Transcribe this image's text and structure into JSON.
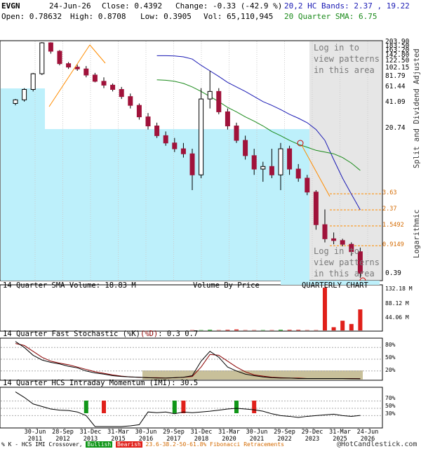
{
  "header": {
    "symbol": "EVGN",
    "date": "24-Jun-26",
    "close": "Close: 0.4392",
    "change": "Change: -0.33 (-42.9 %)",
    "bands": "20,2 HC Bands: 2.37 , 19.22",
    "open": "Open: 0.78632",
    "high": "High: 0.8708",
    "low": "Low: 0.3905",
    "vol": "Vol: 65,110,945",
    "sma": "20 Quarter SMA: 6.75"
  },
  "main_chart": {
    "login_top": [
      "Log in to",
      "view patterns",
      "in this area"
    ],
    "login_bottom": [
      "Log in to",
      "view patterns",
      "in this area"
    ],
    "side_label_split": "Split and Dividend Adjusted",
    "side_label_log": "Logarithmic",
    "y_labels": [
      "203.90",
      "183.50",
      "163.20",
      "142.80",
      "122.50",
      "102.15",
      "81.79",
      "61.44",
      "41.09",
      "20.74",
      "0.39"
    ],
    "fib_labels": [
      "3.63",
      "2.37",
      "1.5492",
      "0.9149"
    ]
  },
  "volume_panel": {
    "title": "14 Quarter SMA Volume: 18.83 M",
    "vbp": "Volume By Price",
    "quarterly": "QUARTERLY CHART",
    "y_labels": [
      "132.18 M",
      "88.12 M",
      "44.06 M"
    ]
  },
  "stoch_panel": {
    "title_pre": "14 Quarter Fast Stochastic (%K)",
    "title_d": "(%D)",
    "title_vals": ": 0.3     0.7",
    "y_labels": [
      "80%",
      "50%",
      "20%"
    ]
  },
  "imi_panel": {
    "title": "14 Quarter HCS Intraday Momentum (IMI): 30.5",
    "y_labels": [
      "70%",
      "50%",
      "30%"
    ]
  },
  "x_axis": {
    "labels": [
      [
        "30-Jun",
        "2011"
      ],
      [
        "28-Sep",
        "2012"
      ],
      [
        "31-Dec",
        "2013"
      ],
      [
        "31-Mar",
        "2015"
      ],
      [
        "30-Jun",
        "2016"
      ],
      [
        "29-Sep",
        "2017"
      ],
      [
        "31-Dec",
        "2018"
      ],
      [
        "31-Mar",
        "2020"
      ],
      [
        "30-Jun",
        "2021"
      ],
      [
        "29-Sep",
        "2022"
      ],
      [
        "29-Dec",
        "2023"
      ],
      [
        "31-Mar",
        "2025"
      ],
      [
        "24-Jun",
        "2026"
      ]
    ]
  },
  "footer": {
    "left": "% K - HCS IMI Crossover,",
    "bullish": "Bullish",
    "bearish": "Bearish",
    "fib": "23.6-38.2-50-61.8% Fibonacci Retracements",
    "copyright": "@HotCandlestick.com"
  },
  "colors": {
    "up_candle": "#ffffff",
    "down_candle": "#a0123a",
    "upper_band": "#1a1ab4",
    "sma": "#1a8a1a",
    "fib": "#ff8c00",
    "vbp": "#bdf0fb",
    "shade": "#e6e6e6"
  },
  "chart_data": [
    {
      "type": "candlestick",
      "title": "EVGN",
      "y_scale": "log",
      "ylim": [
        0.39,
        203.9
      ],
      "series": [
        {
          "name": "20,2 HC Bands",
          "values": [
            null,
            null,
            null,
            null,
            null,
            null,
            null,
            null,
            null,
            null,
            null,
            null,
            null,
            null,
            null,
            null,
            null,
            null,
            null,
            null,
            142,
            142,
            141,
            138,
            130,
            110,
            95,
            82,
            70,
            62,
            55,
            48,
            42,
            38,
            34,
            30,
            27,
            24,
            20,
            15,
            9,
            5.5,
            3.6,
            2.37
          ]
        },
        {
          "name": "20 Quarter SMA",
          "values": [
            null,
            null,
            null,
            null,
            null,
            null,
            null,
            null,
            null,
            null,
            null,
            null,
            null,
            null,
            null,
            null,
            null,
            null,
            null,
            null,
            75,
            74,
            72,
            68,
            62,
            55,
            48,
            42,
            36,
            32,
            28,
            25,
            22,
            19,
            17,
            15,
            13.5,
            12.5,
            11.5,
            11,
            10.5,
            9.5,
            8.2,
            6.75
          ]
        }
      ],
      "candles": [
        {
          "o": 40,
          "h": 45,
          "l": 38,
          "c": 44
        },
        {
          "o": 44,
          "h": 60,
          "l": 42,
          "c": 58
        },
        {
          "o": 58,
          "h": 90,
          "l": 55,
          "c": 88
        },
        {
          "o": 88,
          "h": 203.9,
          "l": 85,
          "c": 200
        },
        {
          "o": 200,
          "h": 203,
          "l": 150,
          "c": 160
        },
        {
          "o": 160,
          "h": 165,
          "l": 110,
          "c": 115
        },
        {
          "o": 115,
          "h": 120,
          "l": 100,
          "c": 105
        },
        {
          "o": 105,
          "h": 112,
          "l": 95,
          "c": 100
        },
        {
          "o": 100,
          "h": 108,
          "l": 80,
          "c": 85
        },
        {
          "o": 85,
          "h": 90,
          "l": 70,
          "c": 72
        },
        {
          "o": 72,
          "h": 80,
          "l": 60,
          "c": 65
        },
        {
          "o": 65,
          "h": 68,
          "l": 55,
          "c": 58
        },
        {
          "o": 58,
          "h": 62,
          "l": 45,
          "c": 48
        },
        {
          "o": 48,
          "h": 52,
          "l": 35,
          "c": 38
        },
        {
          "o": 38,
          "h": 40,
          "l": 26,
          "c": 28
        },
        {
          "o": 28,
          "h": 31,
          "l": 20,
          "c": 22
        },
        {
          "o": 22,
          "h": 24,
          "l": 16,
          "c": 17
        },
        {
          "o": 17,
          "h": 19,
          "l": 13,
          "c": 14
        },
        {
          "o": 14,
          "h": 16,
          "l": 11,
          "c": 12
        },
        {
          "o": 12,
          "h": 14,
          "l": 9.5,
          "c": 10.5
        },
        {
          "o": 10.5,
          "h": 12,
          "l": 4,
          "c": 6
        },
        {
          "o": 6,
          "h": 60,
          "l": 5.5,
          "c": 45
        },
        {
          "o": 45,
          "h": 95,
          "l": 35,
          "c": 55
        },
        {
          "o": 55,
          "h": 60,
          "l": 30,
          "c": 32
        },
        {
          "o": 32,
          "h": 35,
          "l": 20,
          "c": 22
        },
        {
          "o": 22,
          "h": 24,
          "l": 14,
          "c": 15
        },
        {
          "o": 15,
          "h": 17,
          "l": 9,
          "c": 10
        },
        {
          "o": 10,
          "h": 12,
          "l": 6,
          "c": 7
        },
        {
          "o": 7,
          "h": 8.5,
          "l": 5,
          "c": 7.5
        },
        {
          "o": 7.5,
          "h": 12,
          "l": 5.5,
          "c": 6
        },
        {
          "o": 6,
          "h": 14,
          "l": 4,
          "c": 12
        },
        {
          "o": 12,
          "h": 13,
          "l": 6,
          "c": 7
        },
        {
          "o": 7,
          "h": 8,
          "l": 5,
          "c": 5.5
        },
        {
          "o": 5.5,
          "h": 6,
          "l": 3.5,
          "c": 3.8
        },
        {
          "o": 3.8,
          "h": 4,
          "l": 1.4,
          "c": 1.6
        },
        {
          "o": 1.6,
          "h": 2.4,
          "l": 1.0,
          "c": 1.1
        },
        {
          "o": 1.1,
          "h": 1.3,
          "l": 0.95,
          "c": 1.05
        },
        {
          "o": 1.05,
          "h": 1.1,
          "l": 0.9,
          "c": 0.95
        },
        {
          "o": 0.95,
          "h": 1.0,
          "l": 0.7,
          "c": 0.78
        },
        {
          "o": 0.78,
          "h": 0.87,
          "l": 0.39,
          "c": 0.4392
        }
      ]
    },
    {
      "type": "bar",
      "title": "14 Quarter SMA Volume: 18.83 M",
      "ylim": [
        0,
        132.18
      ],
      "values": [
        0,
        0,
        0,
        0,
        0,
        0,
        0,
        0,
        0,
        0,
        0,
        0,
        0,
        0,
        0,
        0,
        0,
        0,
        0,
        0,
        1,
        1,
        2,
        1,
        2,
        3,
        1,
        1,
        1,
        1,
        2,
        2,
        2,
        1,
        1,
        132,
        10,
        30,
        20,
        65
      ]
    },
    {
      "type": "line",
      "title": "14 Quarter Fast Stochastic (%K)(%D): 0.3 0.7",
      "ylim": [
        0,
        100
      ],
      "series": [
        {
          "name": "%K",
          "values": [
            95,
            80,
            60,
            48,
            42,
            38,
            32,
            28,
            20,
            15,
            12,
            8,
            6,
            5,
            4,
            3,
            2,
            2,
            3,
            4,
            8,
            45,
            70,
            55,
            30,
            20,
            12,
            8,
            5,
            3,
            2,
            2,
            1,
            1,
            1,
            1,
            1,
            1,
            0.5,
            0.3
          ]
        },
        {
          "name": "%D",
          "values": [
            90,
            85,
            70,
            55,
            45,
            40,
            36,
            30,
            24,
            18,
            14,
            10,
            7,
            5,
            4,
            3,
            3,
            2,
            3,
            4,
            6,
            30,
            62,
            60,
            45,
            30,
            18,
            10,
            7,
            4,
            3,
            2,
            2,
            1,
            1,
            1,
            1,
            1,
            0.8,
            0.7
          ]
        }
      ]
    },
    {
      "type": "line",
      "title": "14 Quarter HCS Intraday Momentum (IMI): 30.5",
      "ylim": [
        0,
        100
      ],
      "series": [
        {
          "name": "IMI",
          "values": [
            95,
            80,
            62,
            55,
            48,
            45,
            44,
            40,
            30,
            0,
            0,
            0,
            0,
            2,
            5,
            40,
            38,
            40,
            35,
            40,
            38,
            40,
            42,
            45,
            48,
            50,
            48,
            46,
            42,
            35,
            30,
            28,
            25,
            28,
            30,
            32,
            34,
            30,
            28,
            30.5
          ]
        }
      ]
    }
  ]
}
